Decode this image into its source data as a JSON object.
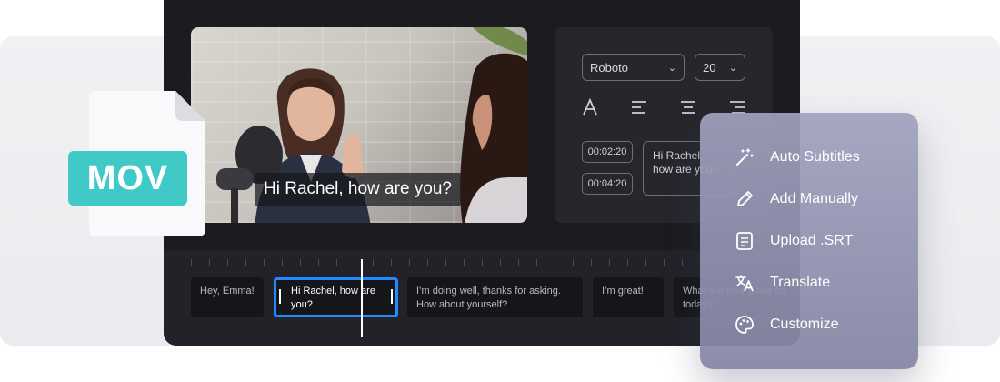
{
  "file_badge": {
    "label": "MOV"
  },
  "video": {
    "caption": "Hi Rachel, how are you?"
  },
  "style_panel": {
    "font_family": "Roboto",
    "font_size": "20",
    "timestamps": [
      "00:02:20",
      "00:04:20"
    ],
    "text_preview": "Hi Rachel, how are you?"
  },
  "timeline": {
    "clips": [
      "Hey, Emma!",
      "Hi Rachel, how are you?",
      "I’m doing well, thanks for asking. How about yourself?",
      "I’m great!",
      "What are your plans for today?"
    ]
  },
  "menu": {
    "items": [
      {
        "label": "Auto Subtitles",
        "icon": "magic-wand-icon"
      },
      {
        "label": "Add Manually",
        "icon": "pencil-icon"
      },
      {
        "label": "Upload .SRT",
        "icon": "document-icon"
      },
      {
        "label": "Translate",
        "icon": "translate-icon"
      },
      {
        "label": "Customize",
        "icon": "palette-icon"
      }
    ]
  },
  "colors": {
    "accent": "#1f8bff",
    "badge": "#3fcac8",
    "editor_bg": "#1b1b20"
  }
}
